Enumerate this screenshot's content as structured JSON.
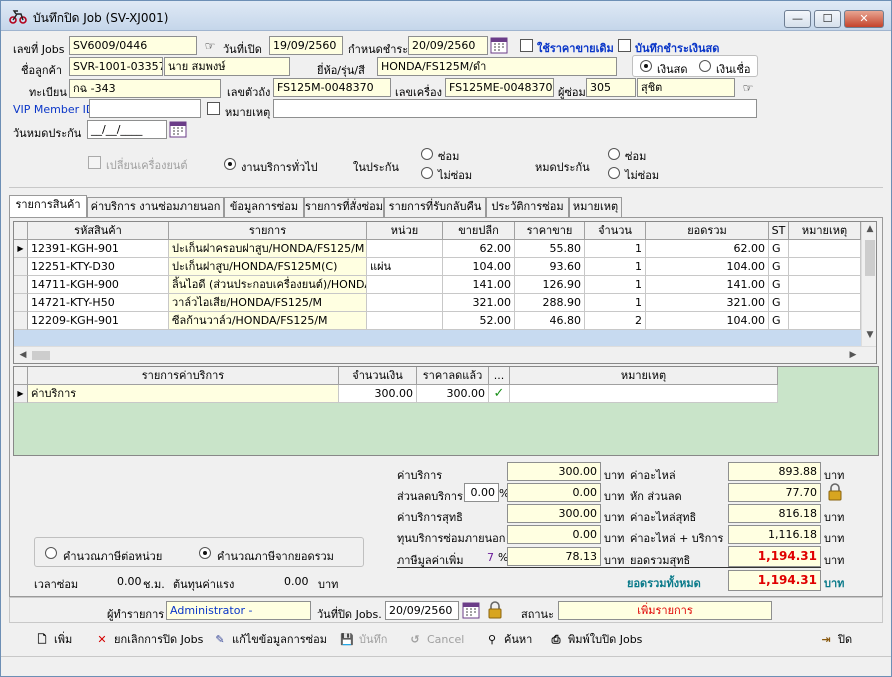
{
  "window": {
    "title": "บันทึกปิด Job (SV-XJ001)",
    "controls": {
      "minimize": "—",
      "maximize": "☐",
      "close": "✕"
    }
  },
  "header": {
    "job_no_label": "เลขที่ Jobs",
    "job_no": "SV6009/0446",
    "open_date_label": "วันที่เปิด",
    "open_date": "19/09/2560",
    "due_label": "กำหนดชำระ",
    "due_date": "20/09/2560",
    "use_old_price_label": "ใช้ราคาขายเดิม",
    "record_cash_label": "บันทึกชำระเงินสด",
    "customer_label": "ชื่อลูกค้า",
    "customer_code": "SVR-1001-03357",
    "customer_name": "นาย สมพงษ์",
    "brand_label": "ยี่ห้อ/รุ่น/สี",
    "brand_model": "HONDA/FS125M/ดำ",
    "cash_label": "เงินสด",
    "credit_label": "เงินเชื่อ",
    "plate_label": "ทะเบียน",
    "plate": "กฉ -343",
    "chassis_label": "เลขตัวถัง",
    "chassis": "FS125M-0048370",
    "engine_label": "เลขเครื่อง",
    "engine": "FS125ME-0048370",
    "mechanic_label": "ผู้ซ่อม",
    "mechanic_code": "305",
    "mechanic_name": "สุชิต",
    "vip_label": "VIP Member ID",
    "vip_value": "",
    "note_label": "หมายเหตุ",
    "note_value": "",
    "warranty_exp_label": "วันหมดประกัน",
    "warranty_exp_value": "__/__/____",
    "change_engine_label": "เปลี่ยนเครื่องยนต์",
    "general_service_label": "งานบริการทั่วไป",
    "in_warranty_label": "ในประกัน",
    "out_warranty_label": "หมดประกัน",
    "repair_label": "ซ่อม",
    "no_repair_label": "ไม่ซ่อม"
  },
  "tabs": [
    {
      "label": "รายการสินค้า",
      "active": true
    },
    {
      "label": "ค่าบริการ งานซ่อมภายนอก",
      "active": false
    },
    {
      "label": "ข้อมูลการซ่อม",
      "active": false
    },
    {
      "label": "รายการที่สั่งซ่อม",
      "active": false
    },
    {
      "label": "รายการที่รับกลับคืน",
      "active": false
    },
    {
      "label": "ประวัติการซ่อม",
      "active": false
    },
    {
      "label": "หมายเหตุ",
      "active": false
    }
  ],
  "items_table": {
    "columns": [
      "รหัสสินค้า",
      "รายการ",
      "หน่วย",
      "ขายปลีก",
      "ราคาขาย",
      "จำนวน",
      "ยอดรวม",
      "ST",
      "หมายเหตุ"
    ],
    "rows": [
      [
        "12391-KGH-901",
        "ปะเก็นฝาครอบฝาสูบ/HONDA/FS125/M",
        "",
        "62.00",
        "55.80",
        "1",
        "62.00",
        "G",
        ""
      ],
      [
        "12251-KTY-D30",
        "ปะเก็นฝาสูบ/HONDA/FS125M(C)",
        "แผ่น",
        "104.00",
        "93.60",
        "1",
        "104.00",
        "G",
        ""
      ],
      [
        "14711-KGH-900",
        "ลิ้นไอดี (ส่วนประกอบเครื่องยนต์)/HONDA",
        "",
        "141.00",
        "126.90",
        "1",
        "141.00",
        "G",
        ""
      ],
      [
        "14721-KTY-H50",
        "วาล์วไอเสีย/HONDA/FS125/M",
        "",
        "321.00",
        "288.90",
        "1",
        "321.00",
        "G",
        ""
      ],
      [
        "12209-KGH-901",
        "ซีลก้านวาล์ว/HONDA/FS125/M",
        "",
        "52.00",
        "46.80",
        "2",
        "104.00",
        "G",
        ""
      ]
    ]
  },
  "service_table": {
    "columns": [
      "รายการค่าบริการ",
      "จำนวนเงิน",
      "ราคาลดแล้ว",
      "...",
      "หมายเหตุ"
    ],
    "rows": [
      [
        "ค่าบริการ",
        "300.00",
        "300.00",
        "✓",
        ""
      ]
    ]
  },
  "totals": {
    "service_label": "ค่าบริการ",
    "service": "300.00",
    "discount_service_label": "ส่วนลดบริการ",
    "discount_pct": "0.00",
    "discount_service": "0.00",
    "net_service_label": "ค่าบริการสุทธิ",
    "net_service": "300.00",
    "outsource_label": "ทุนบริการซ่อมภายนอก",
    "outsource": "0.00",
    "vat_label": "ภาษีมูลค่าเพิ่ม",
    "vat_pct": "7",
    "vat": "78.13",
    "baht": "บาท",
    "percent": "%",
    "parts_label": "ค่าอะไหล่",
    "parts": "893.88",
    "parts_discount_label": "หัก ส่วนลด",
    "parts_discount": "77.70",
    "net_parts_label": "ค่าอะไหล่สุทธิ",
    "net_parts": "816.18",
    "parts_plus_service_label": "ค่าอะไหล่ + บริการ",
    "parts_plus_service": "1,116.18",
    "net_total_label": "ยอดรวมสุทธิ",
    "net_total": "1,194.31",
    "grand_total_label": "ยอดรวมทั้งหมด",
    "grand_total": "1,194.31"
  },
  "tax_options": {
    "per_unit_label": "คำนวณภาษีต่อหน่วย",
    "from_total_label": "คำนวณภาษีจากยอดรวม"
  },
  "repair_time": {
    "time_label": "เวลาซ่อม",
    "hours": "0.00",
    "hours_unit": "ช.ม.",
    "labor_cost_label": "ต้นทุนค่าแรง",
    "labor_cost": "0.00",
    "labor_unit": "บาท"
  },
  "footer": {
    "recorder_label": "ผู้ทำรายการ",
    "recorder": "Administrator -",
    "close_date_label": "วันที่ปิด Jobs.",
    "close_date": "20/09/2560",
    "status_label": "สถานะ",
    "status": "เพิ่มรายการ"
  },
  "toolbar": {
    "add": "เพิ่ม",
    "cancel_close": "ยกเลิกการปิด Jobs",
    "edit_repair": "แก้ไขข้อมูลการซ่อม",
    "save": "บันทึก",
    "cancel": "Cancel",
    "search": "ค้นหา",
    "print": "พิมพ์ใบปิด Jobs",
    "close": "ปิด"
  },
  "colors": {
    "field_bg": "#ffffe1",
    "grid_empty_bg": "#c9e4c9",
    "accent_blue": "#0a36c8",
    "total_red": "#e00000"
  }
}
